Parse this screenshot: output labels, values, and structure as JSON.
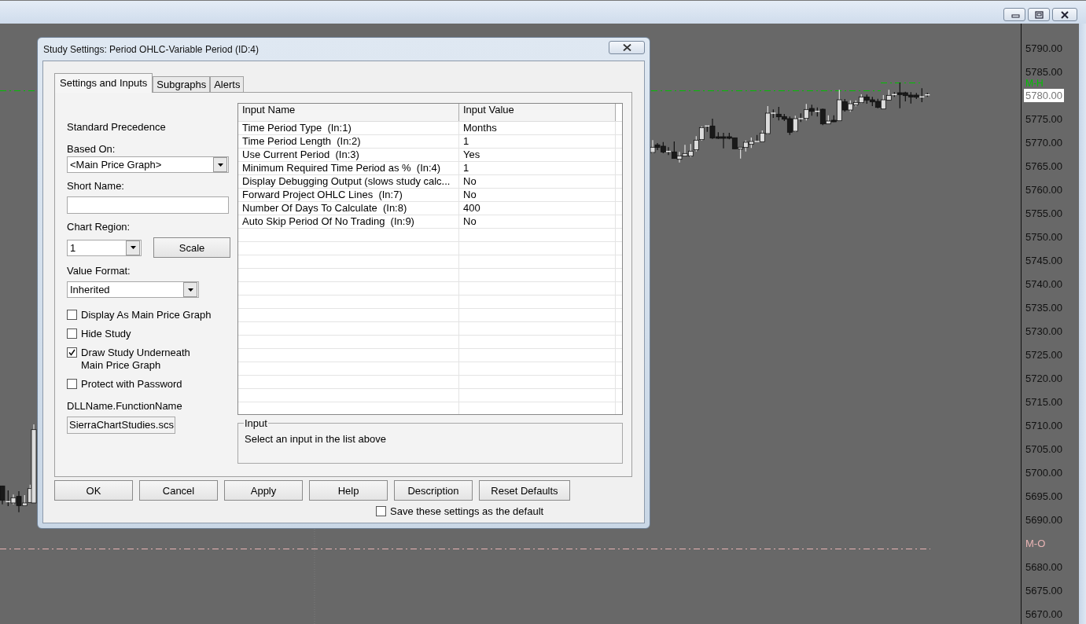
{
  "chart": {
    "price_axis": [
      {
        "kind": "tick",
        "label": "5790.00"
      },
      {
        "kind": "tick",
        "label": "5785.00"
      },
      {
        "kind": "current",
        "label": "5780.00"
      },
      {
        "kind": "tick",
        "label": "5775.00"
      },
      {
        "kind": "tick",
        "label": "5770.00"
      },
      {
        "kind": "tick",
        "label": "5765.00"
      },
      {
        "kind": "tick",
        "label": "5760.00"
      },
      {
        "kind": "tick",
        "label": "5755.00"
      },
      {
        "kind": "tick",
        "label": "5750.00"
      },
      {
        "kind": "tick",
        "label": "5745.00"
      },
      {
        "kind": "tick",
        "label": "5740.00"
      },
      {
        "kind": "tick",
        "label": "5735.00"
      },
      {
        "kind": "tick",
        "label": "5730.00"
      },
      {
        "kind": "tick",
        "label": "5725.00"
      },
      {
        "kind": "tick",
        "label": "5720.00"
      },
      {
        "kind": "tick",
        "label": "5715.00"
      },
      {
        "kind": "tick",
        "label": "5710.00"
      },
      {
        "kind": "tick",
        "label": "5705.00"
      },
      {
        "kind": "tick",
        "label": "5700.00"
      },
      {
        "kind": "tick",
        "label": "5695.00"
      },
      {
        "kind": "tick",
        "label": "5690.00"
      },
      {
        "kind": "marker",
        "label": "M-O",
        "color": "#e8b4b4"
      },
      {
        "kind": "tick",
        "label": "5680.00"
      },
      {
        "kind": "tick",
        "label": "5675.00"
      },
      {
        "kind": "tick",
        "label": "5670.00"
      }
    ],
    "marker": {
      "label": "M-H",
      "color": "#00c000"
    }
  },
  "dialog": {
    "title": "Study Settings: Period OHLC-Variable Period (ID:4)",
    "tabs": [
      {
        "label": "Settings and Inputs",
        "selected": true
      },
      {
        "label": "Subgraphs",
        "selected": false
      },
      {
        "label": "Alerts",
        "selected": false
      }
    ],
    "settings": [
      {
        "kind": "label",
        "text": "Standard Precedence"
      },
      {
        "kind": "label",
        "text": "Based On:"
      },
      {
        "kind": "dropdown",
        "value": "<Main Price Graph>"
      },
      {
        "kind": "label",
        "text": "Short Name:"
      },
      {
        "kind": "field"
      },
      {
        "kind": "label",
        "text": "Chart Region:"
      },
      {
        "kind": "dropdown",
        "value": "1",
        "button": "Scale"
      },
      {
        "kind": "label",
        "text": "Value Format:"
      },
      {
        "kind": "dropdown",
        "value": "Inherited"
      },
      {
        "kind": "checkbox",
        "label": "Display As Main Price Graph",
        "checked": false
      },
      {
        "kind": "checkbox",
        "label": "Hide Study",
        "checked": false
      },
      {
        "kind": "checkbox",
        "label": "Draw Study Underneath\nMain Price Graph",
        "checked": true
      },
      {
        "kind": "checkbox",
        "label": "Protect with Password",
        "checked": false
      },
      {
        "kind": "label",
        "text": "DLLName.FunctionName"
      },
      {
        "kind": "field",
        "value": "SierraChartStudies.scs"
      }
    ],
    "table": {
      "columns": [
        "Input Name",
        "Input Value"
      ],
      "rows": [
        [
          "Time Period Type  (In:1)",
          "Months"
        ],
        [
          "Time Period Length  (In:2)",
          "1"
        ],
        [
          "Use Current Period  (In:3)",
          "Yes"
        ],
        [
          "Minimum Required Time Period as %  (In:4)",
          "1"
        ],
        [
          "Display Debugging Output (slows study calc...",
          "No"
        ],
        [
          "Forward Project OHLC Lines  (In:7)",
          "No"
        ],
        [
          "Number Of Days To Calculate  (In:8)",
          "400"
        ],
        [
          "Auto Skip Period Of No Trading  (In:9)",
          "No"
        ]
      ]
    },
    "input_group": {
      "title": "Input",
      "text": "Select an input in the list above"
    },
    "buttons": [
      "OK",
      "Cancel",
      "Apply",
      "Help",
      "Description",
      "Reset Defaults"
    ],
    "save_default": {
      "label": "Save these settings as the default",
      "checked": false
    }
  }
}
